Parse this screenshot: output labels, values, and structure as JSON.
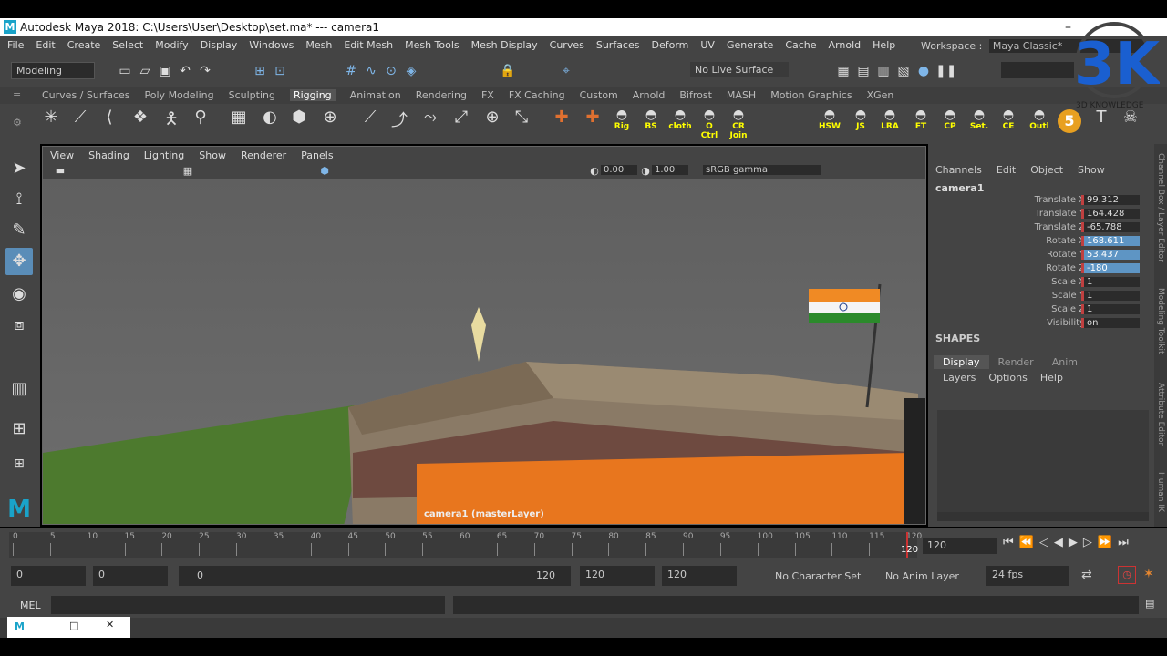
{
  "window": {
    "title": "Autodesk Maya 2018: C:\\Users\\User\\Desktop\\set.ma*   ---   camera1",
    "logo_letter": "M"
  },
  "menubar": [
    "File",
    "Edit",
    "Create",
    "Select",
    "Modify",
    "Display",
    "Windows",
    "Mesh",
    "Edit Mesh",
    "Mesh Tools",
    "Mesh Display",
    "Curves",
    "Surfaces",
    "Deform",
    "UV",
    "Generate",
    "Cache",
    "Arnold",
    "Help"
  ],
  "workspace": {
    "label": "Workspace :",
    "value": "Maya Classic*"
  },
  "status": {
    "mode": "Modeling",
    "live_surface": "No Live Surface"
  },
  "shelf_tabs": [
    "Curves / Surfaces",
    "Poly Modeling",
    "Sculpting",
    "Rigging",
    "Animation",
    "Rendering",
    "FX",
    "FX Caching",
    "Custom",
    "Arnold",
    "Bifrost",
    "MASH",
    "Motion Graphics",
    "XGen"
  ],
  "shelf_active": "Rigging",
  "shelf_buttons": [
    {
      "label": "Rig"
    },
    {
      "label": "BS"
    },
    {
      "label": "cloth"
    },
    {
      "label": "O Ctrl"
    },
    {
      "label": "CR Join"
    },
    {
      "label": "HSW"
    },
    {
      "label": "JS"
    },
    {
      "label": "LRA"
    },
    {
      "label": "FT"
    },
    {
      "label": "CP"
    },
    {
      "label": "Set."
    },
    {
      "label": "CE"
    },
    {
      "label": "Outl"
    }
  ],
  "viewport": {
    "menu": [
      "View",
      "Shading",
      "Lighting",
      "Show",
      "Renderer",
      "Panels"
    ],
    "near_value": "0.00",
    "far_value": "1.00",
    "color_space": "sRGB gamma",
    "camera_label": "camera1 (masterLayer)"
  },
  "channel_box": {
    "menu": [
      "Channels",
      "Edit",
      "Object",
      "Show"
    ],
    "object": "camera1",
    "channels": [
      {
        "name": "Translate X",
        "value": "99.312",
        "hl": false
      },
      {
        "name": "Translate Y",
        "value": "164.428",
        "hl": false
      },
      {
        "name": "Translate Z",
        "value": "-65.788",
        "hl": false
      },
      {
        "name": "Rotate X",
        "value": "168.611",
        "hl": true
      },
      {
        "name": "Rotate Y",
        "value": "53.437",
        "hl": true
      },
      {
        "name": "Rotate Z",
        "value": "-180",
        "hl": true
      },
      {
        "name": "Scale X",
        "value": "1",
        "hl": false
      },
      {
        "name": "Scale Y",
        "value": "1",
        "hl": false
      },
      {
        "name": "Scale Z",
        "value": "1",
        "hl": false
      },
      {
        "name": "Visibility",
        "value": "on",
        "hl": false
      }
    ],
    "shapes_label": "SHAPES"
  },
  "layer_editor": {
    "tabs": [
      "Display",
      "Render",
      "Anim"
    ],
    "menu": [
      "Layers",
      "Options",
      "Help"
    ]
  },
  "side_tabs": [
    "Channel Box / Layer Editor",
    "Modeling Toolkit",
    "Attribute Editor",
    "Human IK"
  ],
  "timeline": {
    "ticks": [
      "0",
      "5",
      "10",
      "15",
      "20",
      "25",
      "30",
      "35",
      "40",
      "45",
      "50",
      "55",
      "60",
      "65",
      "70",
      "75",
      "80",
      "85",
      "90",
      "95",
      "100",
      "105",
      "110",
      "115",
      "120"
    ],
    "current_frame": "120",
    "end_label": "120"
  },
  "range": {
    "start": "0",
    "playback_start": "0",
    "slider_start": "0",
    "slider_end": "120",
    "playback_end": "120",
    "end": "120",
    "character_set": "No Character Set",
    "anim_layer": "No Anim Layer",
    "fps": "24 fps"
  },
  "command_line": {
    "language": "MEL"
  },
  "watermark": {
    "text": "3D KNOWLEDGE",
    "big": "3K"
  }
}
